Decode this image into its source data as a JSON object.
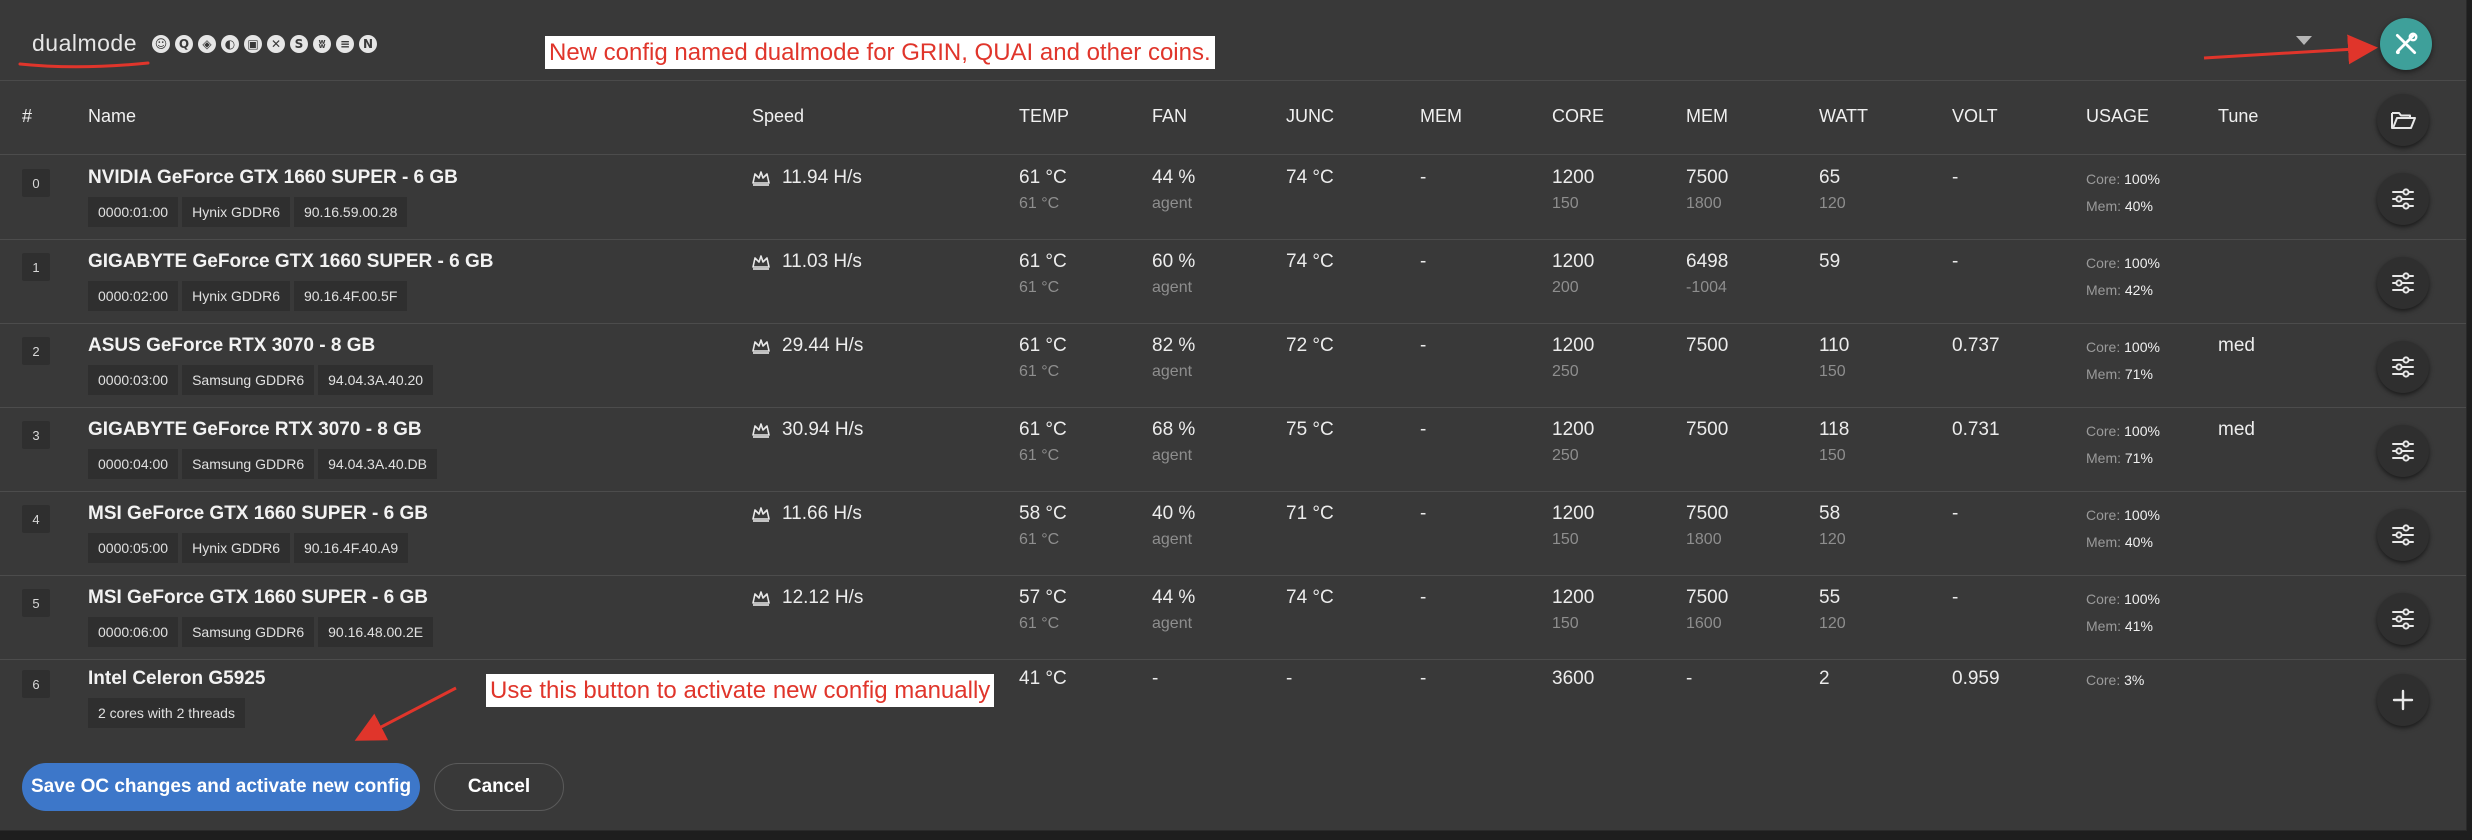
{
  "config": {
    "name": "dualmode"
  },
  "algo_icons": [
    "smile-icon",
    "q-coin-icon",
    "cube-icon",
    "leaf-coin-icon",
    "box-coin-icon",
    "x-coin-icon",
    "swirl-coin-icon",
    "cat-coin-icon",
    "equal-coin-icon",
    "n-coin-icon"
  ],
  "algo_glyphs": [
    "☺",
    "Q",
    "◈",
    "◐",
    "▣",
    "✕",
    "S",
    "ʬ",
    "≡",
    "N"
  ],
  "annotations": {
    "top": "New config named dualmode for GRIN, QUAI and other coins.",
    "bottom": "Use this button to activate new config manually"
  },
  "colors": {
    "accent_teal": "#3ea09a",
    "primary_blue": "#3d77c9",
    "annotation_red": "#e0352b"
  },
  "headers": {
    "idx": "#",
    "name": "Name",
    "speed": "Speed",
    "temp": "TEMP",
    "fan": "FAN",
    "junc": "JUNC",
    "mem": "MEM",
    "core": "CORE",
    "mem2": "MEM",
    "watt": "WATT",
    "volt": "VOLT",
    "usage": "USAGE",
    "tune": "Tune"
  },
  "devices": [
    {
      "idx": "0",
      "name": "NVIDIA GeForce GTX 1660 SUPER - 6 GB",
      "bus": "0000:01:00",
      "memtype": "Hynix GDDR6",
      "bios": "90.16.59.00.28",
      "speed": "11.94 H/s",
      "temp": "61 °C",
      "temp_sub": "61 °C",
      "fan": "44 %",
      "fan_sub": "agent",
      "junc": "74 °C",
      "mem": "-",
      "core": "1200",
      "core_sub": "150",
      "memclk": "7500",
      "memclk_sub": "1800",
      "watt": "65",
      "watt_sub": "120",
      "volt": "-",
      "usage_core_label": "Core:",
      "usage_core": "100%",
      "usage_mem_label": "Mem:",
      "usage_mem": "40%",
      "tune": ""
    },
    {
      "idx": "1",
      "name": "GIGABYTE GeForce GTX 1660 SUPER - 6 GB",
      "bus": "0000:02:00",
      "memtype": "Hynix GDDR6",
      "bios": "90.16.4F.00.5F",
      "speed": "11.03 H/s",
      "temp": "61 °C",
      "temp_sub": "61 °C",
      "fan": "60 %",
      "fan_sub": "agent",
      "junc": "74 °C",
      "mem": "-",
      "core": "1200",
      "core_sub": "200",
      "memclk": "6498",
      "memclk_sub": "-1004",
      "watt": "59",
      "watt_sub": "",
      "volt": "-",
      "usage_core_label": "Core:",
      "usage_core": "100%",
      "usage_mem_label": "Mem:",
      "usage_mem": "42%",
      "tune": ""
    },
    {
      "idx": "2",
      "name": "ASUS GeForce RTX 3070 - 8 GB",
      "bus": "0000:03:00",
      "memtype": "Samsung GDDR6",
      "bios": "94.04.3A.40.20",
      "speed": "29.44 H/s",
      "temp": "61 °C",
      "temp_sub": "61 °C",
      "fan": "82 %",
      "fan_sub": "agent",
      "junc": "72 °C",
      "mem": "-",
      "core": "1200",
      "core_sub": "250",
      "memclk": "7500",
      "memclk_sub": "",
      "watt": "110",
      "watt_sub": "150",
      "volt": "0.737",
      "usage_core_label": "Core:",
      "usage_core": "100%",
      "usage_mem_label": "Mem:",
      "usage_mem": "71%",
      "tune": "med"
    },
    {
      "idx": "3",
      "name": "GIGABYTE GeForce RTX 3070 - 8 GB",
      "bus": "0000:04:00",
      "memtype": "Samsung GDDR6",
      "bios": "94.04.3A.40.DB",
      "speed": "30.94 H/s",
      "temp": "61 °C",
      "temp_sub": "61 °C",
      "fan": "68 %",
      "fan_sub": "agent",
      "junc": "75 °C",
      "mem": "-",
      "core": "1200",
      "core_sub": "250",
      "memclk": "7500",
      "memclk_sub": "",
      "watt": "118",
      "watt_sub": "150",
      "volt": "0.731",
      "usage_core_label": "Core:",
      "usage_core": "100%",
      "usage_mem_label": "Mem:",
      "usage_mem": "71%",
      "tune": "med"
    },
    {
      "idx": "4",
      "name": "MSI GeForce GTX 1660 SUPER - 6 GB",
      "bus": "0000:05:00",
      "memtype": "Hynix GDDR6",
      "bios": "90.16.4F.40.A9",
      "speed": "11.66 H/s",
      "temp": "58 °C",
      "temp_sub": "61 °C",
      "fan": "40 %",
      "fan_sub": "agent",
      "junc": "71 °C",
      "mem": "-",
      "core": "1200",
      "core_sub": "150",
      "memclk": "7500",
      "memclk_sub": "1800",
      "watt": "58",
      "watt_sub": "120",
      "volt": "-",
      "usage_core_label": "Core:",
      "usage_core": "100%",
      "usage_mem_label": "Mem:",
      "usage_mem": "40%",
      "tune": ""
    },
    {
      "idx": "5",
      "name": "MSI GeForce GTX 1660 SUPER - 6 GB",
      "bus": "0000:06:00",
      "memtype": "Samsung GDDR6",
      "bios": "90.16.48.00.2E",
      "speed": "12.12 H/s",
      "temp": "57 °C",
      "temp_sub": "61 °C",
      "fan": "44 %",
      "fan_sub": "agent",
      "junc": "74 °C",
      "mem": "-",
      "core": "1200",
      "core_sub": "150",
      "memclk": "7500",
      "memclk_sub": "1600",
      "watt": "55",
      "watt_sub": "120",
      "volt": "-",
      "usage_core_label": "Core:",
      "usage_core": "100%",
      "usage_mem_label": "Mem:",
      "usage_mem": "41%",
      "tune": ""
    }
  ],
  "cpu": {
    "idx": "6",
    "name": "Intel Celeron G5925",
    "info": "2 cores with 2 threads",
    "temp": "41 °C",
    "fan": "-",
    "junc": "-",
    "mem": "-",
    "core": "3600",
    "memclk": "-",
    "watt": "2",
    "volt": "0.959",
    "usage_core_label": "Core:",
    "usage_core": "3%"
  },
  "buttons": {
    "save": "Save OC changes and activate new config",
    "cancel": "Cancel"
  }
}
